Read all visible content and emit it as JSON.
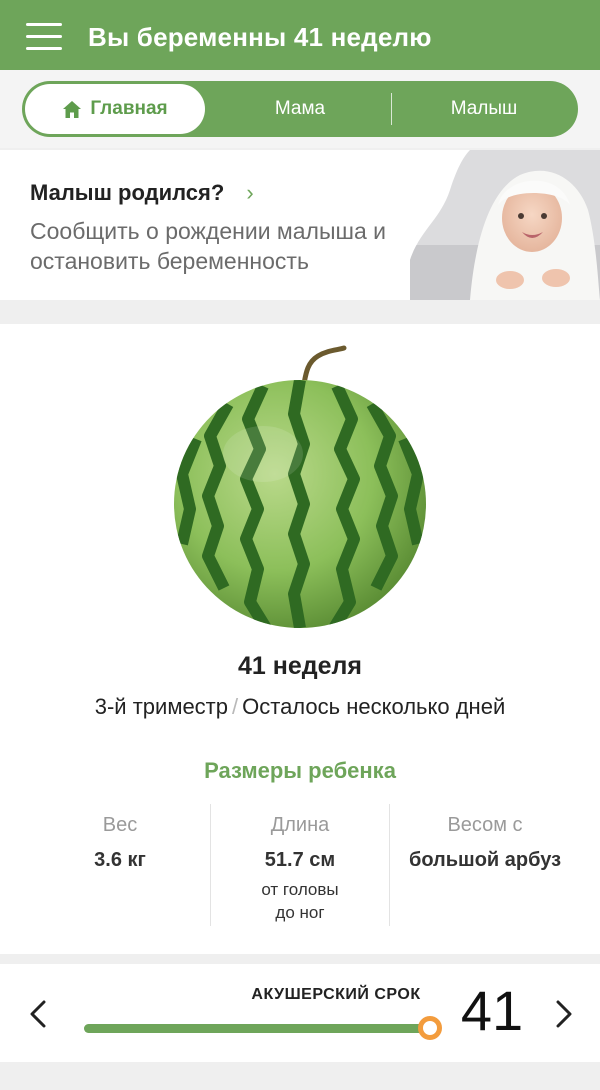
{
  "header": {
    "title": "Вы беременны 41 неделю",
    "menu_icon": "hamburger-menu-icon"
  },
  "tabs": [
    {
      "label": "Главная",
      "icon": "home-icon",
      "active": true
    },
    {
      "label": "Мама",
      "active": false
    },
    {
      "label": "Малыш",
      "active": false
    }
  ],
  "born_card": {
    "title": "Малыш родился?",
    "chevron": "›",
    "description": "Сообщить о рождении малыша и остановить беременность",
    "image": "baby-photo"
  },
  "pregnancy": {
    "week_label": "41 неделя",
    "trimester": "3-й триместр",
    "separator": "/",
    "remaining": "Осталось несколько дней",
    "fruit_image": "watermelon"
  },
  "sizes": {
    "title": "Размеры ребенка",
    "items": [
      {
        "label": "Вес",
        "value": "3.6 кг",
        "note": ""
      },
      {
        "label": "Длина",
        "value": "51.7 см",
        "note_line1": "от головы",
        "note_line2": "до ног"
      },
      {
        "label": "Весом с",
        "value": "большой арбуз",
        "note": ""
      }
    ]
  },
  "term_slider": {
    "label": "АКУШЕРСКИЙ СРОК",
    "week": "41",
    "progress_fraction": 1.0,
    "accent_color": "#6ea55a",
    "thumb_color": "#f39c3d",
    "prev_icon": "chevron-left-icon",
    "next_icon": "chevron-right-icon"
  },
  "colors": {
    "brand_green": "#6ea55a",
    "muted_text": "#6b6b6b"
  }
}
